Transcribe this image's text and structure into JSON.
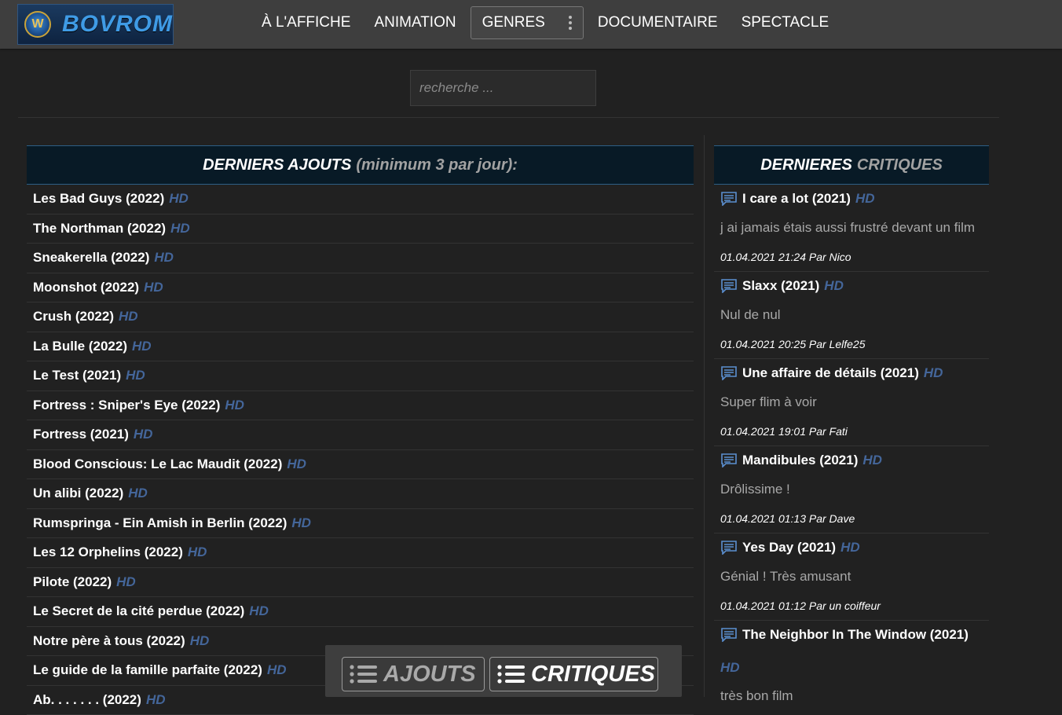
{
  "brand": {
    "name": "BOVROM",
    "emblem": "W"
  },
  "nav": {
    "items": [
      {
        "label": "À L'AFFICHE"
      },
      {
        "label": "ANIMATION"
      },
      {
        "label": "GENRES"
      },
      {
        "label": "DOCUMENTAIRE"
      },
      {
        "label": "SPECTACLE"
      }
    ]
  },
  "search": {
    "placeholder": "recherche ..."
  },
  "latest": {
    "title_main": "DERNIERS AJOUTS",
    "title_sub": "(minimum 3 par jour):",
    "hd_label": "HD",
    "items": [
      "Les Bad Guys (2022)",
      "The Northman (2022)",
      "Sneakerella (2022)",
      "Moonshot (2022)",
      "Crush (2022)",
      "La Bulle (2022)",
      "Le Test (2021)",
      "Fortress : Sniper's Eye (2022)",
      "Fortress (2021)",
      "Blood Conscious: Le Lac Maudit (2022)",
      "Un alibi (2022)",
      "Rumspringa - Ein Amish in Berlin (2022)",
      "Les 12 Orphelins (2022)",
      "Pilote (2022)",
      "Le Secret de la cité perdue (2022)",
      "Notre père à tous (2022)",
      "Le guide de la famille parfaite (2022)",
      "Ab. . . . . . . (2022)"
    ]
  },
  "reviews": {
    "title_main": "DERNIERES",
    "title_sub": "CRITIQUES",
    "hd_label": "HD",
    "items": [
      {
        "title": "I care a lot (2021)",
        "text": "j ai jamais étais aussi frustré devant un film",
        "meta": "01.04.2021 21:24 Par Nico"
      },
      {
        "title": "Slaxx (2021)",
        "text": "Nul de nul",
        "meta": "01.04.2021 20:25 Par Lelfe25"
      },
      {
        "title": "Une affaire de détails (2021)",
        "text": "Super flim à voir",
        "meta": "01.04.2021 19:01 Par Fati"
      },
      {
        "title": "Mandibules (2021)",
        "text": "Drôlissime !",
        "meta": "01.04.2021 01:13 Par Dave"
      },
      {
        "title": "Yes Day (2021)",
        "text": "Génial ! Très amusant",
        "meta": "01.04.2021 01:12 Par un coiffeur"
      },
      {
        "title": "The Neighbor In The Window (2021)",
        "text": "très bon film",
        "meta": ""
      }
    ]
  },
  "floatbar": {
    "ajouts_label": "AJOUTS",
    "critiques_label": "CRITIQUES"
  },
  "colors": {
    "hd": "#44669a",
    "panel_head": "#081a26",
    "topbar": "#3e3e3e",
    "page": "#212121"
  }
}
